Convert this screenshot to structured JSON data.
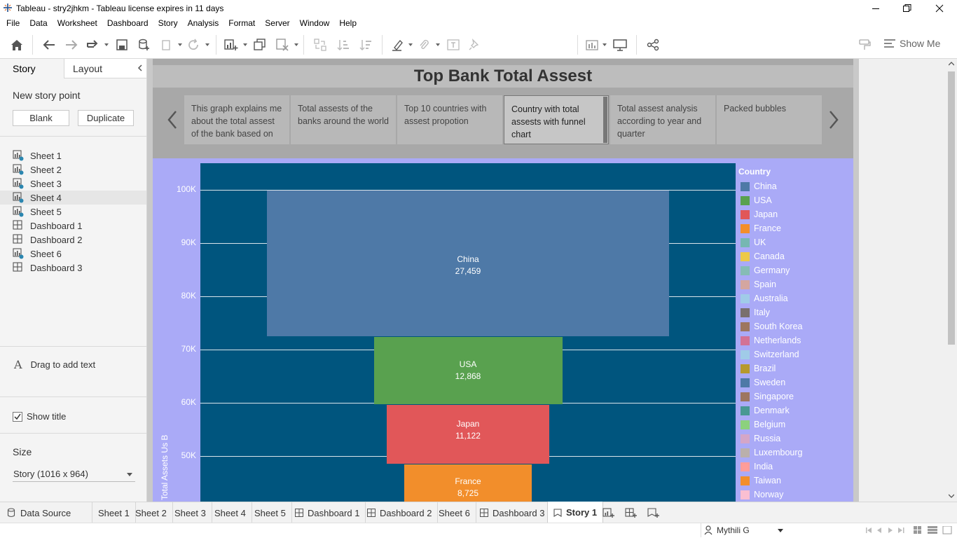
{
  "window": {
    "title": "Tableau - stry2jhkm - Tableau license expires in 11 days"
  },
  "menu": [
    "File",
    "Data",
    "Worksheet",
    "Dashboard",
    "Story",
    "Analysis",
    "Format",
    "Server",
    "Window",
    "Help"
  ],
  "toolbar": {
    "show_me_label": "Show Me"
  },
  "left_pane": {
    "tab_story": "Story",
    "tab_layout": "Layout",
    "new_story_point_label": "New story point",
    "blank_button": "Blank",
    "duplicate_button": "Duplicate",
    "sheets": [
      {
        "label": "Sheet 1",
        "type": "sheet"
      },
      {
        "label": "Sheet 2",
        "type": "sheet"
      },
      {
        "label": "Sheet 3",
        "type": "sheet"
      },
      {
        "label": "Sheet 4",
        "type": "sheet"
      },
      {
        "label": "Sheet 5",
        "type": "sheet"
      },
      {
        "label": "Dashboard 1",
        "type": "dashboard"
      },
      {
        "label": "Dashboard 2",
        "type": "dashboard"
      },
      {
        "label": "Sheet 6",
        "type": "sheet"
      },
      {
        "label": "Dashboard 3",
        "type": "dashboard"
      }
    ],
    "drag_text_label": "Drag to add text",
    "show_title_label": "Show title",
    "show_title_checked": true,
    "size_label": "Size",
    "size_value": "Story (1016 x 964)"
  },
  "story": {
    "title": "Top Bank Total Assest",
    "story_points": [
      "This graph explains me about the total assest of the bank based on",
      "Total assests of the banks around the world",
      "Top 10 countries with assest propotion",
      "Country with total assests with funnel chart",
      "Total assest analysis according to year and quarter",
      "Packed bubbles"
    ],
    "active_story_point": 3
  },
  "chart_data": {
    "type": "bar",
    "subtype": "funnel",
    "ylabel": "Total Assets Us B",
    "y_ticks": [
      "100K",
      "90K",
      "80K",
      "70K",
      "60K",
      "50K"
    ],
    "ylim_visible": [
      43500,
      104800
    ],
    "background_color": "#00557e",
    "bars": [
      {
        "country": "China",
        "label_value": "27,459",
        "top": 100000,
        "bottom": 72541,
        "color": "#4e79a7"
      },
      {
        "country": "USA",
        "label_value": "12,868",
        "top": 72541,
        "bottom": 59673,
        "color": "#59a14f"
      },
      {
        "country": "Japan",
        "label_value": "11,122",
        "top": 59673,
        "bottom": 48551,
        "color": "#e15759"
      },
      {
        "country": "France",
        "label_value": "8,725",
        "top": 48551,
        "bottom": 39826,
        "color": "#f28e2b"
      }
    ],
    "legend": {
      "title": "Country",
      "placement": "right",
      "items": [
        {
          "label": "China",
          "color": "#4e79a7"
        },
        {
          "label": "USA",
          "color": "#59a14f"
        },
        {
          "label": "Japan",
          "color": "#e15759"
        },
        {
          "label": "France",
          "color": "#f28e2b"
        },
        {
          "label": "UK",
          "color": "#76b7b2"
        },
        {
          "label": "Canada",
          "color": "#edc948"
        },
        {
          "label": "Germany",
          "color": "#86bcb6"
        },
        {
          "label": "Spain",
          "color": "#d4a6a0"
        },
        {
          "label": "Australia",
          "color": "#a0cbe8"
        },
        {
          "label": "Italy",
          "color": "#79706e"
        },
        {
          "label": "South Korea",
          "color": "#9d7660"
        },
        {
          "label": "Netherlands",
          "color": "#d37295"
        },
        {
          "label": "Switzerland",
          "color": "#a0cbe8"
        },
        {
          "label": "Brazil",
          "color": "#b6992d"
        },
        {
          "label": "Sweden",
          "color": "#4e79a7"
        },
        {
          "label": "Singapore",
          "color": "#9d7660"
        },
        {
          "label": "Denmark",
          "color": "#499894"
        },
        {
          "label": "Belgium",
          "color": "#8cd17d"
        },
        {
          "label": "Russia",
          "color": "#d4a6c8"
        },
        {
          "label": "Luxembourg",
          "color": "#bab0ac"
        },
        {
          "label": "India",
          "color": "#ff9d9a"
        },
        {
          "label": "Taiwan",
          "color": "#f28e2b"
        },
        {
          "label": "Norway",
          "color": "#fabfd2"
        }
      ]
    }
  },
  "bottom_tabs": {
    "data_source": "Data Source",
    "tabs": [
      {
        "label": "Sheet 1",
        "type": "sheet"
      },
      {
        "label": "Sheet 2",
        "type": "sheet"
      },
      {
        "label": "Sheet 3",
        "type": "sheet"
      },
      {
        "label": "Sheet 4",
        "type": "sheet"
      },
      {
        "label": "Sheet 5",
        "type": "sheet"
      },
      {
        "label": "Dashboard 1",
        "type": "dashboard"
      },
      {
        "label": "Dashboard 2",
        "type": "dashboard"
      },
      {
        "label": "Sheet 6",
        "type": "sheet"
      },
      {
        "label": "Dashboard 3",
        "type": "dashboard"
      },
      {
        "label": "Story 1",
        "type": "story"
      }
    ],
    "active_tab": "Story 1"
  },
  "status": {
    "user": "Mythili G"
  }
}
